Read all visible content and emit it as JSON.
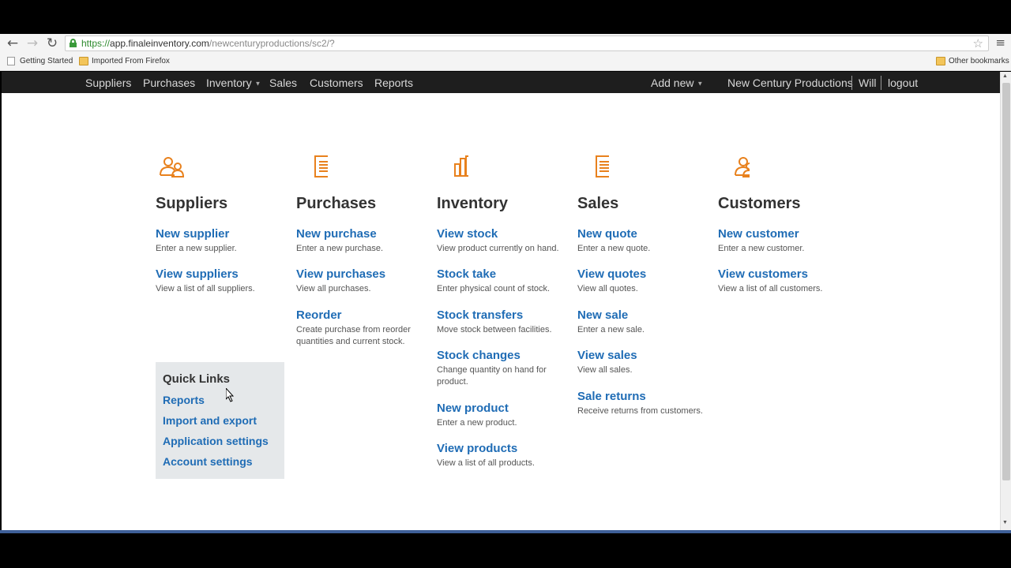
{
  "browser": {
    "url_scheme": "https://",
    "url_host": "app.finaleinventory.com",
    "url_path": "/newcenturyproductions/sc2/?",
    "bookmarks": [
      "Getting Started",
      "Imported From Firefox"
    ],
    "other_bookmarks": "Other bookmarks"
  },
  "nav": {
    "items": [
      "Suppliers",
      "Purchases",
      "Inventory",
      "Sales",
      "Customers",
      "Reports"
    ],
    "add_new": "Add new",
    "company": "New Century Productions",
    "user": "Will",
    "logout": "logout"
  },
  "accent_color": "#e8811d",
  "link_color": "#1f6cb5",
  "sections": [
    {
      "title": "Suppliers",
      "icon": "people-icon",
      "links": [
        {
          "title": "New supplier",
          "desc": "Enter a new supplier."
        },
        {
          "title": "View suppliers",
          "desc": "View a list of all suppliers."
        }
      ]
    },
    {
      "title": "Purchases",
      "icon": "document-icon",
      "links": [
        {
          "title": "New purchase",
          "desc": "Enter a new purchase."
        },
        {
          "title": "View purchases",
          "desc": "View all purchases."
        },
        {
          "title": "Reorder",
          "desc": "Create purchase from reorder quantities and current stock."
        }
      ]
    },
    {
      "title": "Inventory",
      "icon": "bar-chart-icon",
      "links": [
        {
          "title": "View stock",
          "desc": "View product currently on hand."
        },
        {
          "title": "Stock take",
          "desc": "Enter physical count of stock."
        },
        {
          "title": "Stock transfers",
          "desc": "Move stock between facilities."
        },
        {
          "title": "Stock changes",
          "desc": "Change quantity on hand for product."
        },
        {
          "title": "New product",
          "desc": "Enter a new product."
        },
        {
          "title": "View products",
          "desc": "View a list of all products."
        }
      ]
    },
    {
      "title": "Sales",
      "icon": "document-icon",
      "links": [
        {
          "title": "New quote",
          "desc": "Enter a new quote."
        },
        {
          "title": "View quotes",
          "desc": "View all quotes."
        },
        {
          "title": "New sale",
          "desc": "Enter a new sale."
        },
        {
          "title": "View sales",
          "desc": "View all sales."
        },
        {
          "title": "Sale returns",
          "desc": "Receive returns from customers."
        }
      ]
    },
    {
      "title": "Customers",
      "icon": "people-icon",
      "links": [
        {
          "title": "New customer",
          "desc": "Enter a new customer."
        },
        {
          "title": "View customers",
          "desc": "View a list of all customers."
        }
      ]
    }
  ],
  "quick_links": {
    "title": "Quick Links",
    "items": [
      "Reports",
      "Import and export",
      "Application settings",
      "Account settings"
    ]
  }
}
